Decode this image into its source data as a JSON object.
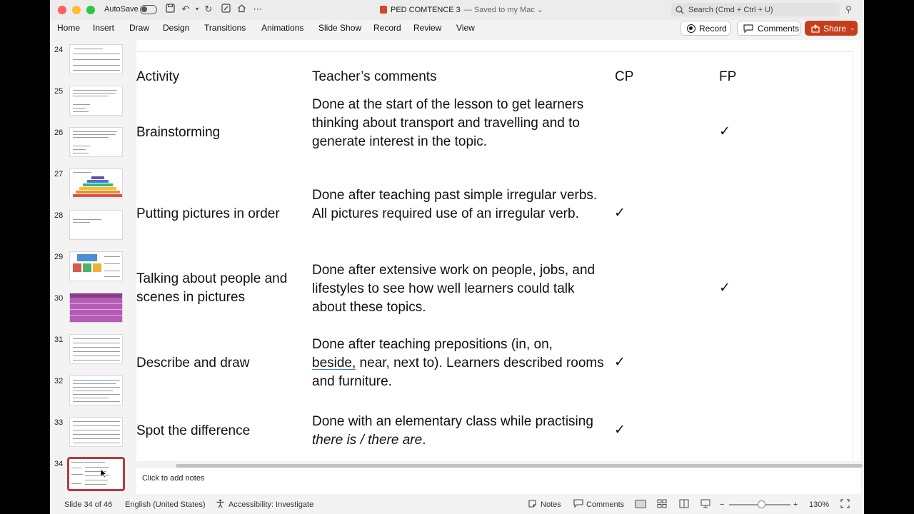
{
  "window": {
    "autosave_label": "AutoSave",
    "doc_title": "PED COMTENCE 3",
    "saved_status": "— Saved to my Mac ⌄",
    "search_placeholder": "Search (Cmd + Ctrl + U)"
  },
  "ribbon": {
    "tabs": [
      "Home",
      "Insert",
      "Draw",
      "Design",
      "Transitions",
      "Animations",
      "Slide Show",
      "Record",
      "Review",
      "View"
    ],
    "record_button": "Record",
    "comments_button": "Comments",
    "share_button": "Share"
  },
  "thumbnails": {
    "numbers": [
      "24",
      "25",
      "26",
      "27",
      "28",
      "29",
      "30",
      "31",
      "32",
      "33",
      "34"
    ],
    "selected": "34"
  },
  "slide": {
    "headers": {
      "activity": "Activity",
      "comments": "Teacher’s comments",
      "cp": "CP",
      "fp": "FP"
    },
    "tick": "✓",
    "rows": [
      {
        "activity": "Brainstorming",
        "comment": "Done at the start of the lesson to get learners thinking about transport and travelling and to generate interest in the topic.",
        "cp": "",
        "fp": "✓"
      },
      {
        "activity": "Putting pictures in order",
        "comment": "Done after teaching past simple irregular verbs. All pictures required use of an irregular verb.",
        "cp": "✓",
        "fp": ""
      },
      {
        "activity": "Talking about people and scenes in pictures",
        "comment": "Done after extensive work on people, jobs, and lifestyles to see how well learners could talk about these topics.",
        "cp": "",
        "fp": "✓"
      },
      {
        "activity": "Describe and draw",
        "comment_before": "Done after teaching prepositions (in, on,",
        "comment_underlined": "beside,",
        "comment_after": " near, next to). Learners described rooms and furniture.",
        "cp": "✓",
        "fp": ""
      },
      {
        "activity": "Spot the difference",
        "comment_before": "Done with an elementary class while practising ",
        "comment_italic": "there is / there are",
        "comment_after": ".",
        "cp": "✓",
        "fp": ""
      }
    ]
  },
  "notes": {
    "placeholder": "Click to add notes"
  },
  "status": {
    "slide_counter": "Slide 34 of 46",
    "language": "English (United States)",
    "accessibility": "Accessibility: Investigate",
    "notes_button": "Notes",
    "comments_button": "Comments",
    "zoom": "130%"
  }
}
